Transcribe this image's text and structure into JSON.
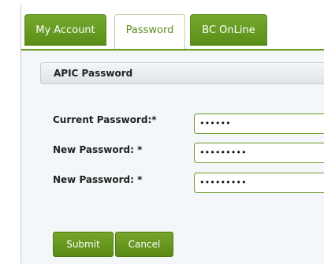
{
  "tabs": [
    {
      "label": "My Account",
      "active": false
    },
    {
      "label": "Password",
      "active": true
    },
    {
      "label": "BC OnLine",
      "active": false
    }
  ],
  "panel": {
    "title": "APIC Password"
  },
  "form": {
    "current_label": "Current Password:*",
    "current_value": "••••••",
    "new_label": "New Password: *",
    "new_value": "•••••••••",
    "confirm_label": "New Password: *",
    "confirm_value": "•••••••••"
  },
  "buttons": {
    "submit_label": "Submit",
    "cancel_label": "Cancel"
  },
  "colors": {
    "accent_green": "#5a8d18",
    "panel_bg": "#f4f7f9"
  }
}
